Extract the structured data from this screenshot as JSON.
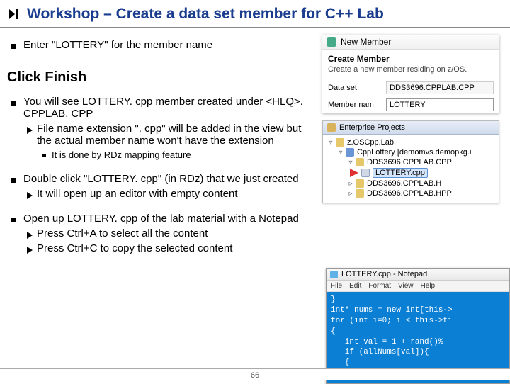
{
  "header": {
    "title": "Workshop – Create a data set member for C++ Lab"
  },
  "left": {
    "b1": "Enter \"LOTTERY\" for the member name",
    "click_finish": "Click Finish",
    "b2": "You will see LOTTERY. cpp member created under <HLQ>. CPPLAB. CPP",
    "b2s1": "File name extension \". cpp\" will be added in the view but the actual member name won't have the extension",
    "b2s1a": "It is done by RDz mapping feature",
    "b3": "Double click \"LOTTERY. cpp\" (in RDz) that we just created",
    "b3s1": "It will open up an editor with empty content",
    "b4": "Open up LOTTERY. cpp of the lab material with a Notepad",
    "b4s1": "Press Ctrl+A to select all the content",
    "b4s2": "Press  Ctrl+C to copy the selected content"
  },
  "wizard": {
    "window_label": "New Member",
    "title": "Create Member",
    "desc": "Create a new member residing on z/OS.",
    "dataset_label": "Data set:",
    "dataset_value": "DDS3696.CPPLAB.CPP",
    "member_label": "Member nam",
    "member_value": "LOTTERY"
  },
  "tree": {
    "tab": "Enterprise Projects",
    "root": "z.OSCpp.Lab",
    "n1": "CppLottery  [demomvs.demopkg.i",
    "n2": "DDS3696.CPPLAB.CPP",
    "n2a": "LOTTERY.cpp",
    "n3": "DDS3696.CPPLAB.H",
    "n4": "DDS3696.CPPLAB.HPP"
  },
  "notepad": {
    "title": "LOTTERY.cpp - Notepad",
    "menu": [
      "File",
      "Edit",
      "Format",
      "View",
      "Help"
    ],
    "code": "}\nint* nums = new int[this->\nfor (int i=0; i < this->ti\n{\n   int val = 1 + rand()%\n   if (allNums[val]){\n   {\n      i--;"
  },
  "footer": {
    "page": "66"
  }
}
